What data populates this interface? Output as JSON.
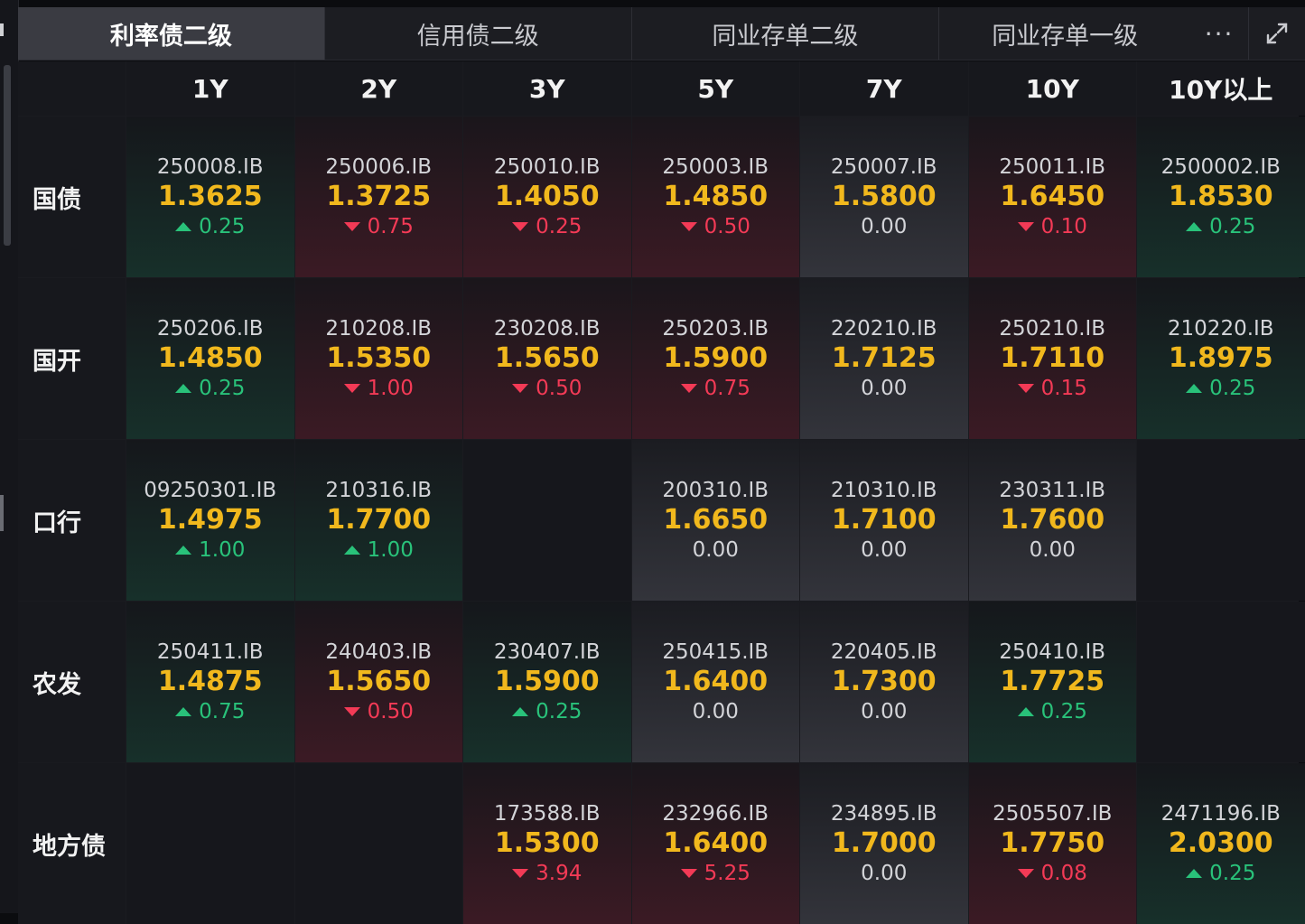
{
  "tabs": [
    {
      "label": "利率债二级",
      "active": true
    },
    {
      "label": "信用债二级",
      "active": false
    },
    {
      "label": "同业存单二级",
      "active": false
    },
    {
      "label": "同业存单一级",
      "active": false
    }
  ],
  "more_label": "···",
  "icons": {
    "more": "more-dots-icon",
    "expand": "expand-icon"
  },
  "colors": {
    "yield": "#f1b81d",
    "up": "#29c27a",
    "down": "#f33a56",
    "flat": "#d3d4d8"
  },
  "columns": [
    "1Y",
    "2Y",
    "3Y",
    "5Y",
    "7Y",
    "10Y",
    "10Y以上"
  ],
  "rows": [
    {
      "label": "国债",
      "cells": [
        {
          "code": "250008.IB",
          "yield": "1.3625",
          "change": "0.25",
          "dir": "up"
        },
        {
          "code": "250006.IB",
          "yield": "1.3725",
          "change": "0.75",
          "dir": "down"
        },
        {
          "code": "250010.IB",
          "yield": "1.4050",
          "change": "0.25",
          "dir": "down"
        },
        {
          "code": "250003.IB",
          "yield": "1.4850",
          "change": "0.50",
          "dir": "down"
        },
        {
          "code": "250007.IB",
          "yield": "1.5800",
          "change": "0.00",
          "dir": "flat"
        },
        {
          "code": "250011.IB",
          "yield": "1.6450",
          "change": "0.10",
          "dir": "down"
        },
        {
          "code": "2500002.IB",
          "yield": "1.8530",
          "change": "0.25",
          "dir": "up"
        }
      ]
    },
    {
      "label": "国开",
      "cells": [
        {
          "code": "250206.IB",
          "yield": "1.4850",
          "change": "0.25",
          "dir": "up"
        },
        {
          "code": "210208.IB",
          "yield": "1.5350",
          "change": "1.00",
          "dir": "down"
        },
        {
          "code": "230208.IB",
          "yield": "1.5650",
          "change": "0.50",
          "dir": "down"
        },
        {
          "code": "250203.IB",
          "yield": "1.5900",
          "change": "0.75",
          "dir": "down"
        },
        {
          "code": "220210.IB",
          "yield": "1.7125",
          "change": "0.00",
          "dir": "flat"
        },
        {
          "code": "250210.IB",
          "yield": "1.7110",
          "change": "0.15",
          "dir": "down"
        },
        {
          "code": "210220.IB",
          "yield": "1.8975",
          "change": "0.25",
          "dir": "up"
        }
      ]
    },
    {
      "label": "口行",
      "cells": [
        {
          "code": "09250301.IB",
          "yield": "1.4975",
          "change": "1.00",
          "dir": "up"
        },
        {
          "code": "210316.IB",
          "yield": "1.7700",
          "change": "1.00",
          "dir": "up"
        },
        null,
        {
          "code": "200310.IB",
          "yield": "1.6650",
          "change": "0.00",
          "dir": "flat"
        },
        {
          "code": "210310.IB",
          "yield": "1.7100",
          "change": "0.00",
          "dir": "flat"
        },
        {
          "code": "230311.IB",
          "yield": "1.7600",
          "change": "0.00",
          "dir": "flat"
        },
        null
      ]
    },
    {
      "label": "农发",
      "cells": [
        {
          "code": "250411.IB",
          "yield": "1.4875",
          "change": "0.75",
          "dir": "up"
        },
        {
          "code": "240403.IB",
          "yield": "1.5650",
          "change": "0.50",
          "dir": "down"
        },
        {
          "code": "230407.IB",
          "yield": "1.5900",
          "change": "0.25",
          "dir": "up"
        },
        {
          "code": "250415.IB",
          "yield": "1.6400",
          "change": "0.00",
          "dir": "flat"
        },
        {
          "code": "220405.IB",
          "yield": "1.7300",
          "change": "0.00",
          "dir": "flat"
        },
        {
          "code": "250410.IB",
          "yield": "1.7725",
          "change": "0.25",
          "dir": "up"
        },
        null
      ]
    },
    {
      "label": "地方债",
      "cells": [
        null,
        null,
        {
          "code": "173588.IB",
          "yield": "1.5300",
          "change": "3.94",
          "dir": "down"
        },
        {
          "code": "232966.IB",
          "yield": "1.6400",
          "change": "5.25",
          "dir": "down"
        },
        {
          "code": "234895.IB",
          "yield": "1.7000",
          "change": "0.00",
          "dir": "flat"
        },
        {
          "code": "2505507.IB",
          "yield": "1.7750",
          "change": "0.08",
          "dir": "down"
        },
        {
          "code": "2471196.IB",
          "yield": "2.0300",
          "change": "0.25",
          "dir": "up"
        }
      ]
    }
  ]
}
